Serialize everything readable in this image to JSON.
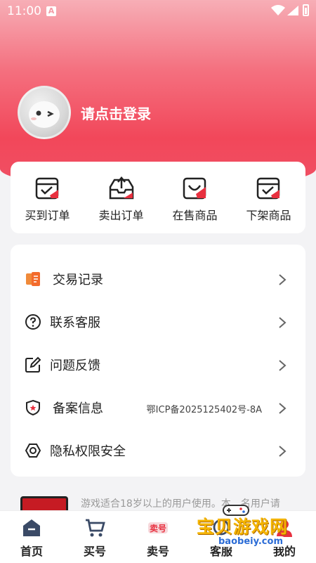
{
  "status_bar": {
    "time": "11:00",
    "notification_icon": "A"
  },
  "profile": {
    "login_prompt": "请点击登录"
  },
  "orders": [
    {
      "label": "买到订单",
      "icon": "bought-orders-icon"
    },
    {
      "label": "卖出订单",
      "icon": "sold-orders-icon"
    },
    {
      "label": "在售商品",
      "icon": "on-sale-icon"
    },
    {
      "label": "下架商品",
      "icon": "off-shelf-icon"
    }
  ],
  "menu": [
    {
      "label": "交易记录",
      "value": "",
      "icon": "transaction-record-icon"
    },
    {
      "label": "联系客服",
      "value": "",
      "icon": "help-question-icon"
    },
    {
      "label": "问题反馈",
      "value": "",
      "icon": "edit-feedback-icon"
    },
    {
      "label": "备案信息",
      "value": "鄂ICP备2025125402号-8A",
      "icon": "shield-star-icon"
    },
    {
      "label": "隐私权限安全",
      "value": "",
      "icon": "privacy-ring-icon"
    }
  ],
  "notice": {
    "text": "游戏适合18岁以上的用户使用。本…名用户请"
  },
  "tabbar": [
    {
      "label": "首页",
      "icon": "home-icon"
    },
    {
      "label": "买号",
      "icon": "cart-icon"
    },
    {
      "label": "卖号",
      "icon": "sell-badge-icon",
      "badge": "卖号"
    },
    {
      "label": "客服",
      "icon": "service-icon"
    },
    {
      "label": "我的",
      "icon": "profile-icon"
    }
  ],
  "watermark": {
    "text": "宝贝游戏网",
    "url": "baobeiy.com"
  },
  "colors": {
    "accent": "#f2475a",
    "hero_top": "#f7aeb6",
    "icon_red": "#e8303f"
  }
}
